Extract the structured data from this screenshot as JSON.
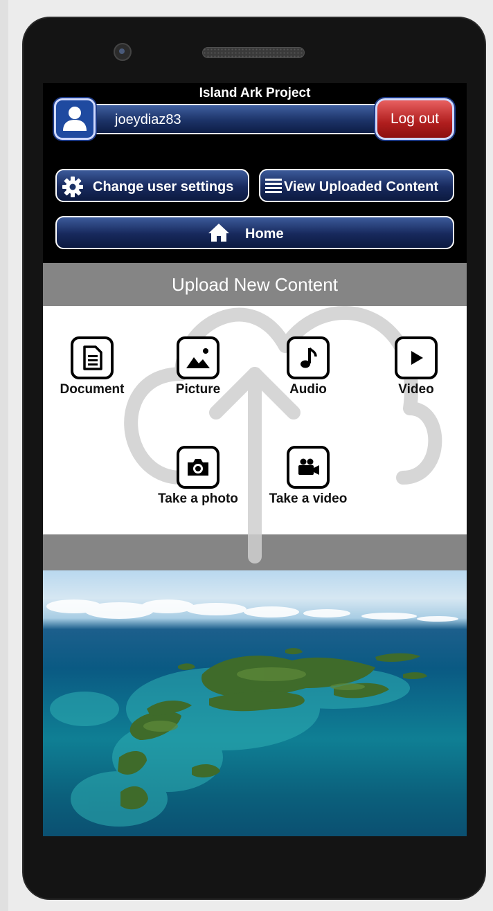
{
  "app": {
    "title": "Island Ark Project"
  },
  "user": {
    "username": "joeydiaz83"
  },
  "buttons": {
    "logout": "Log out",
    "change_settings": "Change user settings",
    "view_uploaded": "View Uploaded Content",
    "home": "Home"
  },
  "upload": {
    "header": "Upload New Content",
    "items": [
      {
        "label": "Document",
        "icon": "document-icon"
      },
      {
        "label": "Picture",
        "icon": "picture-icon"
      },
      {
        "label": "Audio",
        "icon": "audio-icon"
      },
      {
        "label": "Video",
        "icon": "video-icon"
      },
      {
        "label": "Take a photo",
        "icon": "camera-icon"
      },
      {
        "label": "Take a video",
        "icon": "video-camera-icon"
      }
    ]
  },
  "colors": {
    "button_blue": "#1c3368",
    "logout_red": "#b01e1e",
    "header_gray": "#858585"
  }
}
